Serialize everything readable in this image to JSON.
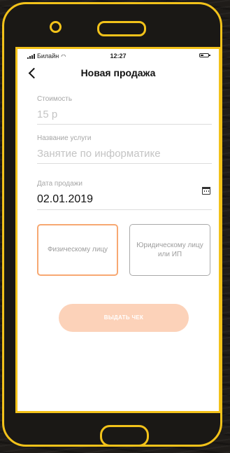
{
  "status_bar": {
    "carrier": "Билайн",
    "time": "12:27"
  },
  "nav": {
    "title": "Новая продажа"
  },
  "form": {
    "price": {
      "label": "Стоимость",
      "value": "15 р"
    },
    "service": {
      "label": "Название услуги",
      "value": "Занятие по информатике"
    },
    "date": {
      "label": "Дата продажи",
      "value": "02.01.2019"
    }
  },
  "recipient": {
    "individual": "Физическому лицу",
    "legal": "Юридическому лицу или ИП",
    "selected": "individual"
  },
  "actions": {
    "receipt_label": "ВЫДАТЬ ЧЕК"
  },
  "colors": {
    "frame": "#f2c21a",
    "accent": "#f7a872",
    "button_disabled": "#fcd2b9"
  },
  "icons": [
    "signal-icon",
    "wifi-icon",
    "battery-icon",
    "back-chevron-icon",
    "calendar-icon"
  ]
}
